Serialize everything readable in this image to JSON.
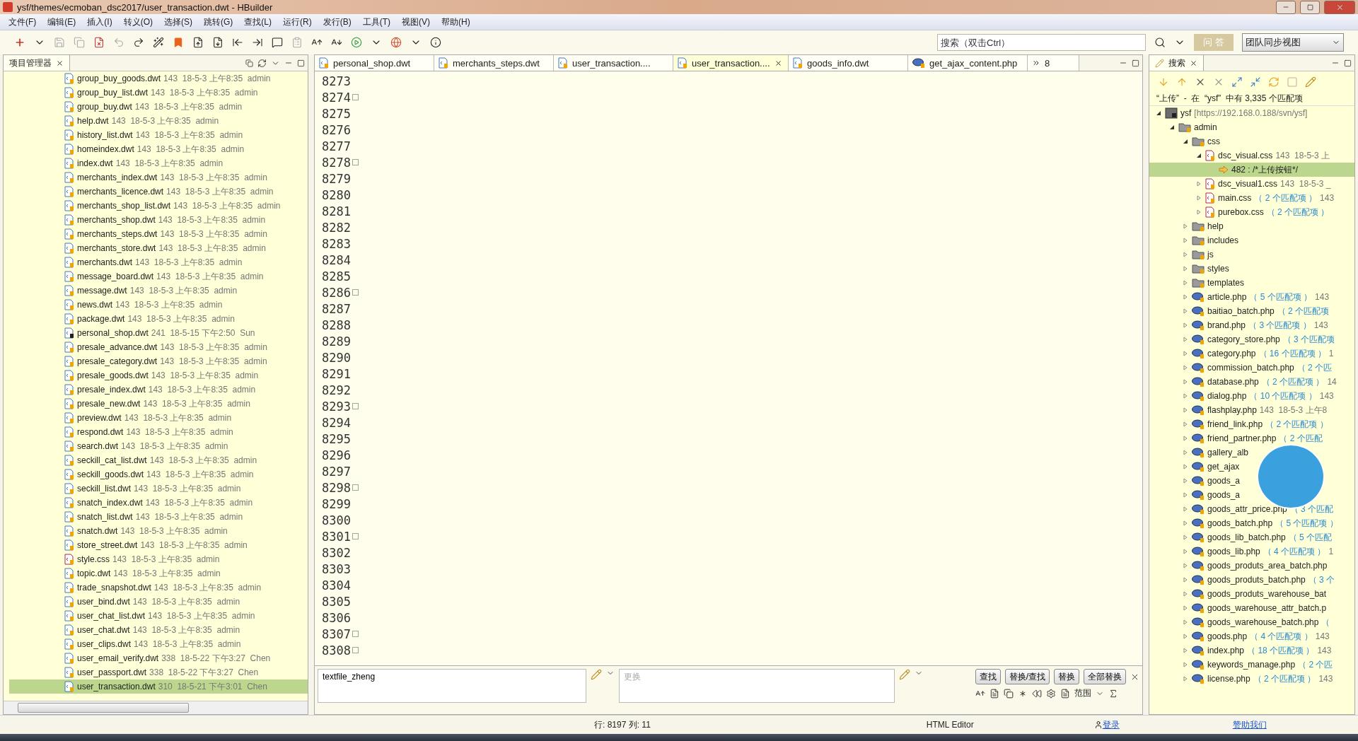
{
  "window": {
    "title": "ysf/themes/ecmoban_dsc2017/user_transaction.dwt  -  HBuilder"
  },
  "menu": [
    "文件(F)",
    "编辑(E)",
    "插入(I)",
    "转义(O)",
    "选择(S)",
    "跳转(G)",
    "查找(L)",
    "运行(R)",
    "发行(B)",
    "工具(T)",
    "视图(V)",
    "帮助(H)"
  ],
  "toolbar": {
    "search": {
      "placeholder": "搜索（双击Ctrl）"
    },
    "qa_button": "问 答",
    "perspective": "团队同步视图"
  },
  "project_panel": {
    "title": "项目管理器",
    "files": [
      {
        "name": "group_buy_goods.dwt",
        "info": "143  18-5-3 上午8:35  admin",
        "kind": "dwt",
        "selected": false
      },
      {
        "name": "group_buy_list.dwt",
        "info": "143  18-5-3 上午8:35  admin",
        "kind": "dwt",
        "selected": false
      },
      {
        "name": "group_buy.dwt",
        "info": "143  18-5-3 上午8:35  admin",
        "kind": "dwt",
        "selected": false
      },
      {
        "name": "help.dwt",
        "info": "143  18-5-3 上午8:35  admin",
        "kind": "dwt",
        "selected": false
      },
      {
        "name": "history_list.dwt",
        "info": "143  18-5-3 上午8:35  admin",
        "kind": "dwt",
        "selected": false
      },
      {
        "name": "homeindex.dwt",
        "info": "143  18-5-3 上午8:35  admin",
        "kind": "dwt",
        "selected": false
      },
      {
        "name": "index.dwt",
        "info": "143  18-5-3 上午8:35  admin",
        "kind": "dwt",
        "selected": false
      },
      {
        "name": "merchants_index.dwt",
        "info": "143  18-5-3 上午8:35  admin",
        "kind": "dwt",
        "selected": false
      },
      {
        "name": "merchants_licence.dwt",
        "info": "143  18-5-3 上午8:35  admin",
        "kind": "dwt",
        "selected": false
      },
      {
        "name": "merchants_shop_list.dwt",
        "info": "143  18-5-3 上午8:35  admin",
        "kind": "dwt",
        "selected": false
      },
      {
        "name": "merchants_shop.dwt",
        "info": "143  18-5-3 上午8:35  admin",
        "kind": "dwt",
        "selected": false
      },
      {
        "name": "merchants_steps.dwt",
        "info": "143  18-5-3 上午8:35  admin",
        "kind": "dwt",
        "selected": false
      },
      {
        "name": "merchants_store.dwt",
        "info": "143  18-5-3 上午8:35  admin",
        "kind": "dwt",
        "selected": false
      },
      {
        "name": "merchants.dwt",
        "info": "143  18-5-3 上午8:35  admin",
        "kind": "dwt",
        "selected": false
      },
      {
        "name": "message_board.dwt",
        "info": "143  18-5-3 上午8:35  admin",
        "kind": "dwt",
        "selected": false
      },
      {
        "name": "message.dwt",
        "info": "143  18-5-3 上午8:35  admin",
        "kind": "dwt",
        "selected": false
      },
      {
        "name": "news.dwt",
        "info": "143  18-5-3 上午8:35  admin",
        "kind": "dwt",
        "selected": false
      },
      {
        "name": "package.dwt",
        "info": "143  18-5-3 上午8:35  admin",
        "kind": "dwt",
        "selected": false
      },
      {
        "name": "personal_shop.dwt",
        "info": "241  18-5-15 下午2:50  Sun",
        "kind": "modified",
        "selected": false
      },
      {
        "name": "presale_advance.dwt",
        "info": "143  18-5-3 上午8:35  admin",
        "kind": "dwt",
        "selected": false
      },
      {
        "name": "presale_category.dwt",
        "info": "143  18-5-3 上午8:35  admin",
        "kind": "dwt",
        "selected": false
      },
      {
        "name": "presale_goods.dwt",
        "info": "143  18-5-3 上午8:35  admin",
        "kind": "dwt",
        "selected": false
      },
      {
        "name": "presale_index.dwt",
        "info": "143  18-5-3 上午8:35  admin",
        "kind": "dwt",
        "selected": false
      },
      {
        "name": "presale_new.dwt",
        "info": "143  18-5-3 上午8:35  admin",
        "kind": "dwt",
        "selected": false
      },
      {
        "name": "preview.dwt",
        "info": "143  18-5-3 上午8:35  admin",
        "kind": "dwt",
        "selected": false
      },
      {
        "name": "respond.dwt",
        "info": "143  18-5-3 上午8:35  admin",
        "kind": "dwt",
        "selected": false
      },
      {
        "name": "search.dwt",
        "info": "143  18-5-3 上午8:35  admin",
        "kind": "dwt",
        "selected": false
      },
      {
        "name": "seckill_cat_list.dwt",
        "info": "143  18-5-3 上午8:35  admin",
        "kind": "dwt",
        "selected": false
      },
      {
        "name": "seckill_goods.dwt",
        "info": "143  18-5-3 上午8:35  admin",
        "kind": "dwt",
        "selected": false
      },
      {
        "name": "seckill_list.dwt",
        "info": "143  18-5-3 上午8:35  admin",
        "kind": "dwt",
        "selected": false
      },
      {
        "name": "snatch_index.dwt",
        "info": "143  18-5-3 上午8:35  admin",
        "kind": "dwt",
        "selected": false
      },
      {
        "name": "snatch_list.dwt",
        "info": "143  18-5-3 上午8:35  admin",
        "kind": "dwt",
        "selected": false
      },
      {
        "name": "snatch.dwt",
        "info": "143  18-5-3 上午8:35  admin",
        "kind": "dwt",
        "selected": false
      },
      {
        "name": "store_street.dwt",
        "info": "143  18-5-3 上午8:35  admin",
        "kind": "dwt",
        "selected": false
      },
      {
        "name": "style.css",
        "info": "143  18-5-3 上午8:35  admin",
        "kind": "css",
        "selected": false
      },
      {
        "name": "topic.dwt",
        "info": "143  18-5-3 上午8:35  admin",
        "kind": "dwt",
        "selected": false
      },
      {
        "name": "trade_snapshot.dwt",
        "info": "143  18-5-3 上午8:35  admin",
        "kind": "dwt",
        "selected": false
      },
      {
        "name": "user_bind.dwt",
        "info": "143  18-5-3 上午8:35  admin",
        "kind": "dwt",
        "selected": false
      },
      {
        "name": "user_chat_list.dwt",
        "info": "143  18-5-3 上午8:35  admin",
        "kind": "dwt",
        "selected": false
      },
      {
        "name": "user_chat.dwt",
        "info": "143  18-5-3 上午8:35  admin",
        "kind": "dwt",
        "selected": false
      },
      {
        "name": "user_clips.dwt",
        "info": "143  18-5-3 上午8:35  admin",
        "kind": "dwt",
        "selected": false
      },
      {
        "name": "user_email_verify.dwt",
        "info": "338  18-5-22 下午3:27  Chen",
        "kind": "dwt",
        "selected": false
      },
      {
        "name": "user_passport.dwt",
        "info": "338  18-5-22 下午3:27  Chen",
        "kind": "dwt",
        "selected": false
      },
      {
        "name": "user_transaction.dwt",
        "info": "310  18-5-21 下午3:01  Chen",
        "kind": "dwt",
        "selected": true
      }
    ]
  },
  "editor": {
    "tabs": [
      {
        "label": "personal_shop.dwt",
        "kind": "dwt",
        "selected": false
      },
      {
        "label": "merchants_steps.dwt",
        "kind": "dwt",
        "selected": false
      },
      {
        "label": "user_transaction....",
        "kind": "dwt",
        "selected": false
      },
      {
        "label": "user_transaction....",
        "kind": "dwt",
        "selected": true
      },
      {
        "label": "goods_info.dwt",
        "kind": "dwt",
        "selected": false
      },
      {
        "label": "get_ajax_content.php",
        "kind": "php",
        "selected": false
      }
    ],
    "hidden_tabs": "8",
    "lines": [
      {
        "number": "8273",
        "fold": false
      },
      {
        "number": "8274",
        "fold": true
      },
      {
        "number": "8275",
        "fold": false
      },
      {
        "number": "8276",
        "fold": false
      },
      {
        "number": "8277",
        "fold": false
      },
      {
        "number": "8278",
        "fold": true
      },
      {
        "number": "8279",
        "fold": false
      },
      {
        "number": "8280",
        "fold": false
      },
      {
        "number": "8281",
        "fold": false
      },
      {
        "number": "8282",
        "fold": false
      },
      {
        "number": "8283",
        "fold": false
      },
      {
        "number": "8284",
        "fold": false
      },
      {
        "number": "8285",
        "fold": false
      },
      {
        "number": "8286",
        "fold": true
      },
      {
        "number": "8287",
        "fold": false
      },
      {
        "number": "8288",
        "fold": false
      },
      {
        "number": "8289",
        "fold": false
      },
      {
        "number": "8290",
        "fold": false
      },
      {
        "number": "8291",
        "fold": false
      },
      {
        "number": "8292",
        "fold": false
      },
      {
        "number": "8293",
        "fold": true
      },
      {
        "number": "8294",
        "fold": false
      },
      {
        "number": "8295",
        "fold": false
      },
      {
        "number": "8296",
        "fold": false
      },
      {
        "number": "8297",
        "fold": false
      },
      {
        "number": "8298",
        "fold": true
      },
      {
        "number": "8299",
        "fold": false
      },
      {
        "number": "8300",
        "fold": false
      },
      {
        "number": "8301",
        "fold": true
      },
      {
        "number": "8302",
        "fold": false
      },
      {
        "number": "8303",
        "fold": false
      },
      {
        "number": "8304",
        "fold": false
      },
      {
        "number": "8305",
        "fold": false
      },
      {
        "number": "8306",
        "fold": false
      },
      {
        "number": "8307",
        "fold": true
      },
      {
        "number": "8308",
        "fold": true
      }
    ]
  },
  "find_bar": {
    "find_value": "textfile_zheng",
    "replace_placeholder": "更换",
    "buttons": [
      "查找",
      "替换/查找",
      "替换",
      "全部替换"
    ],
    "scope": "范围"
  },
  "search_panel": {
    "title": "搜索",
    "summary": "“上传”  -  在  “ysf”  中有 3,335 个匹配项",
    "tree": [
      {
        "name": "ysf",
        "info": "[https://192.168.0.188/svn/ysf]",
        "kind": "project",
        "expanded": true,
        "selected": false,
        "children": [
          {
            "name": "admin",
            "kind": "folder",
            "expanded": true,
            "selected": false,
            "children": [
              {
                "name": "css",
                "kind": "folder",
                "expanded": true,
                "selected": false,
                "children": [
                  {
                    "name": "dsc_visual.css",
                    "info": "143  18-5-3 上",
                    "kind": "css",
                    "expanded": true,
                    "selected": false,
                    "children": [
                      {
                        "name": "482 : /*上传按钮*/",
                        "kind": "match",
                        "selected": true
                      }
                    ]
                  },
                  {
                    "name": "dsc_visual1.css",
                    "info": "143  18-5-3 _",
                    "kind": "css",
                    "expanded": false,
                    "selected": false
                  },
                  {
                    "name": "main.css",
                    "matches": "（ 2 个匹配项 ）",
                    "info": "143",
                    "kind": "css",
                    "expanded": false,
                    "selected": false
                  },
                  {
                    "name": "purebox.css",
                    "matches": "（ 2 个匹配项 ）",
                    "kind": "css",
                    "expanded": false,
                    "selected": false
                  }
                ]
              },
              {
                "name": "help",
                "kind": "folder",
                "expanded": false,
                "selected": false
              },
              {
                "name": "includes",
                "kind": "folder",
                "expanded": false,
                "selected": false
              },
              {
                "name": "js",
                "kind": "folder",
                "expanded": false,
                "selected": false
              },
              {
                "name": "styles",
                "kind": "folder",
                "expanded": false,
                "selected": false
              },
              {
                "name": "templates",
                "kind": "folder",
                "expanded": false,
                "selected": false
              },
              {
                "name": "article.php",
                "matches": "（ 5 个匹配项 ）",
                "info": "143",
                "kind": "php",
                "expanded": false,
                "selected": false
              },
              {
                "name": "baitiao_batch.php",
                "matches": "（ 2 个匹配项",
                "kind": "php",
                "expanded": false,
                "selected": false
              },
              {
                "name": "brand.php",
                "matches": "（ 3 个匹配项 ）",
                "info": "143",
                "kind": "php",
                "expanded": false,
                "selected": false
              },
              {
                "name": "category_store.php",
                "matches": "（ 3 个匹配项",
                "kind": "php",
                "expanded": false,
                "selected": false
              },
              {
                "name": "category.php",
                "matches": "（ 16 个匹配项 ）",
                "info": "1",
                "kind": "php",
                "expanded": false,
                "selected": false
              },
              {
                "name": "commission_batch.php",
                "matches": "（ 2 个匹",
                "kind": "php",
                "expanded": false,
                "selected": false
              },
              {
                "name": "database.php",
                "matches": "（ 2 个匹配项 ）",
                "info": "14",
                "kind": "php",
                "expanded": false,
                "selected": false
              },
              {
                "name": "dialog.php",
                "matches": "（ 10 个匹配项 ）",
                "info": "143",
                "kind": "php",
                "expanded": false,
                "selected": false
              },
              {
                "name": "flashplay.php",
                "info": "143  18-5-3 上午8",
                "kind": "php",
                "expanded": false,
                "selected": false
              },
              {
                "name": "friend_link.php",
                "matches": "（ 2 个匹配项 ）",
                "kind": "php",
                "expanded": false,
                "selected": false
              },
              {
                "name": "friend_partner.php",
                "matches": "（ 2 个匹配",
                "kind": "php",
                "expanded": false,
                "selected": false
              },
              {
                "name": "gallery_alb",
                "kind": "php",
                "expanded": false,
                "selected": false
              },
              {
                "name": "get_ajax",
                "kind": "php",
                "expanded": false,
                "selected": false
              },
              {
                "name": "goods_a",
                "kind": "php",
                "expanded": false,
                "selected": false
              },
              {
                "name": "goods_a",
                "kind": "php",
                "expanded": false,
                "selected": false
              },
              {
                "name": "goods_attr_price.php",
                "matches": "（ 3 个匹配",
                "kind": "php",
                "expanded": false,
                "selected": false
              },
              {
                "name": "goods_batch.php",
                "matches": "（ 5 个匹配项 ）",
                "kind": "php",
                "expanded": false,
                "selected": false
              },
              {
                "name": "goods_lib_batch.php",
                "matches": "（ 5 个匹配",
                "kind": "php",
                "expanded": false,
                "selected": false
              },
              {
                "name": "goods_lib.php",
                "matches": "（ 4 个匹配项 ）",
                "info": "1",
                "kind": "php",
                "expanded": false,
                "selected": false
              },
              {
                "name": "goods_produts_area_batch.php",
                "kind": "php",
                "expanded": false,
                "selected": false
              },
              {
                "name": "goods_produts_batch.php",
                "matches": "（ 3 个",
                "kind": "php",
                "expanded": false,
                "selected": false
              },
              {
                "name": "goods_produts_warehouse_bat",
                "kind": "php",
                "expanded": false,
                "selected": false
              },
              {
                "name": "goods_warehouse_attr_batch.p",
                "kind": "php",
                "expanded": false,
                "selected": false
              },
              {
                "name": "goods_warehouse_batch.php",
                "matches": "（",
                "kind": "php",
                "expanded": false,
                "selected": false
              },
              {
                "name": "goods.php",
                "matches": "（ 4 个匹配项 ）",
                "info": "143",
                "kind": "php",
                "expanded": false,
                "selected": false
              },
              {
                "name": "index.php",
                "matches": "（ 18 个匹配项 ）",
                "info": "143",
                "kind": "php",
                "expanded": false,
                "selected": false
              },
              {
                "name": "keywords_manage.php",
                "matches": "（ 2 个匹",
                "kind": "php",
                "expanded": false,
                "selected": false
              },
              {
                "name": "license.php",
                "matches": "（ 2 个匹配项 ）",
                "info": "143",
                "kind": "php",
                "expanded": false,
                "selected": false
              }
            ]
          }
        ]
      }
    ]
  },
  "status_bar": {
    "position": "行: 8197 列: 11",
    "editor_type": "HTML Editor",
    "login": "登录",
    "sponsor": "赞助我们"
  }
}
